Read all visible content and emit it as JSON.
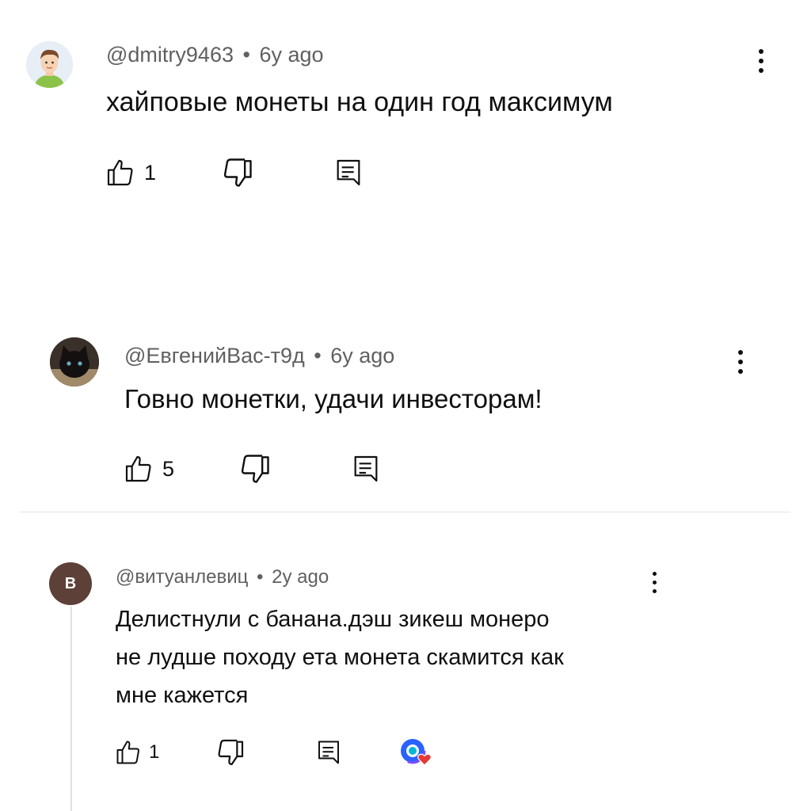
{
  "comments": [
    {
      "author": "@dmitry9463",
      "separator": "•",
      "age": "6y ago",
      "text": "хайповые монеты на один год максимум",
      "likes": "1",
      "avatar_style": "cartoon-man",
      "avatar_bg": "#e8eef5"
    },
    {
      "author": "@ЕвгенийВас-т9д",
      "separator": "•",
      "age": "6y ago",
      "text": "Говно монетки, удачи инвесторам!",
      "likes": "5",
      "avatar_style": "black-cat-photo",
      "avatar_bg": "#2b2420"
    },
    {
      "author": "@витуанлевиц",
      "separator": "•",
      "age": "2y ago",
      "text_lines": [
        "Делистнули с банана.дэш зикеш монеро",
        "не лудше походу ета монета скамится как",
        "мне кажется"
      ],
      "likes": "1",
      "avatar_letter": "В",
      "avatar_bg": "#5d4037",
      "badge_icon": "creator-heart-icon"
    }
  ],
  "colors": {
    "meta_text": "#606060",
    "body_text": "#0f0f0f",
    "heart": "#e53935",
    "badge_blue": "#2962ff"
  }
}
